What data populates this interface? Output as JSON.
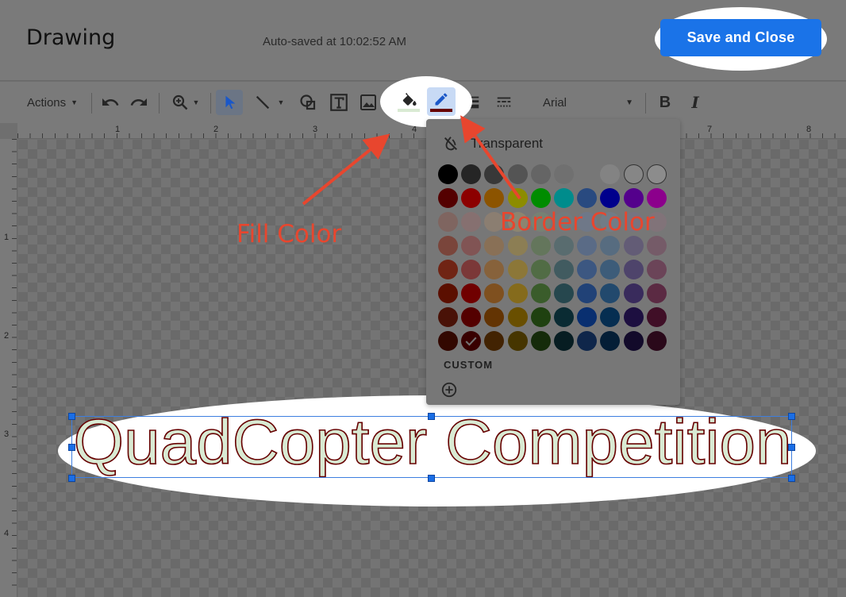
{
  "header": {
    "title": "Drawing",
    "autosave": "Auto-saved at 10:02:52 AM",
    "save_label": "Save and Close"
  },
  "toolbar": {
    "actions_label": "Actions",
    "font": "Arial",
    "icons": [
      "undo-icon",
      "redo-icon",
      "zoom-icon",
      "select-icon",
      "line-icon",
      "shape-icon",
      "textbox-icon",
      "image-icon",
      "fill-color-icon",
      "border-color-icon",
      "border-weight-icon",
      "border-dash-icon",
      "bold-icon",
      "italic-icon"
    ],
    "fill_color": "#d9ead3",
    "border_color": "#660000"
  },
  "ruler": {
    "top": [
      "1",
      "2",
      "3",
      "4",
      "7",
      "8"
    ],
    "left": [
      "1",
      "2",
      "3",
      "4"
    ]
  },
  "palette": {
    "transparent_label": "Transparent",
    "custom_label": "CUSTOM",
    "selected": "#660000",
    "rows": [
      [
        "#000000",
        "#434343",
        "#666666",
        "#999999",
        "#b7b7b7",
        "#cccccc",
        "#d9d9d9",
        "#efefef",
        "#f3f3f3",
        "#ffffff"
      ],
      [
        "#980000",
        "#ff0000",
        "#ff9900",
        "#ffff00",
        "#00ff00",
        "#00ffff",
        "#4a86e8",
        "#0000ff",
        "#9900ff",
        "#ff00ff"
      ],
      [
        "#e6b8af",
        "#f4cccc",
        "#fce5cd",
        "#fff2cc",
        "#d9ead3",
        "#d0e0e3",
        "#c9daf8",
        "#cfe2f3",
        "#d9d2e9",
        "#ead1dc"
      ],
      [
        "#dd7e6b",
        "#ea9999",
        "#f9cb9c",
        "#ffe599",
        "#b6d7a8",
        "#a2c4c9",
        "#a4c2f4",
        "#9fc5e8",
        "#b4a7d6",
        "#d5a6bd"
      ],
      [
        "#cc4125",
        "#e06666",
        "#f6b26b",
        "#ffd966",
        "#93c47d",
        "#76a5af",
        "#6d9eeb",
        "#6fa8dc",
        "#8e7cc3",
        "#c27ba0"
      ],
      [
        "#a61c00",
        "#cc0000",
        "#e69138",
        "#f1c232",
        "#6aa84f",
        "#45818e",
        "#3c78d8",
        "#3d85c6",
        "#674ea7",
        "#a64d79"
      ],
      [
        "#85200c",
        "#990000",
        "#b45f06",
        "#bf9000",
        "#38761d",
        "#134f5c",
        "#1155cc",
        "#0b5394",
        "#351c75",
        "#741b47"
      ],
      [
        "#5b0f00",
        "#660000",
        "#783f04",
        "#7f6000",
        "#274e13",
        "#0c343d",
        "#1c4587",
        "#073763",
        "#20124d",
        "#4c1130"
      ]
    ]
  },
  "annotations": {
    "fill_label": "Fill Color",
    "border_label": "Border Color",
    "color": "#e8462e"
  },
  "canvas": {
    "wordart_text": "QuadCopter Competition",
    "wordart_fill": "#d9ead3",
    "wordart_stroke": "#660000"
  }
}
